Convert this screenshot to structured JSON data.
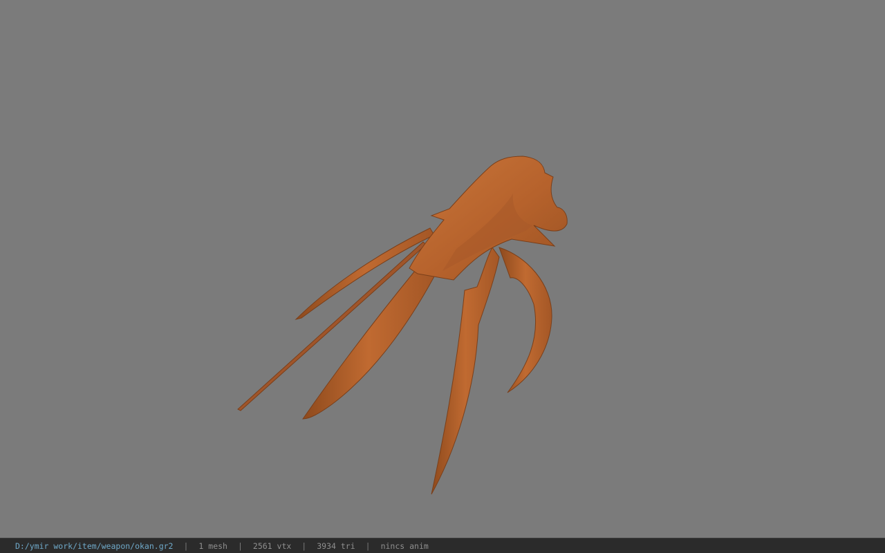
{
  "viewport": {
    "background": "#7b7b7b",
    "model_color": "#b9652e",
    "model_shade": "#8f4a1e",
    "model_highlight": "#cf7c40"
  },
  "statusbar": {
    "path": "D:/ymir work/item/weapon/okan.gr2",
    "separator": "|",
    "mesh": "1 mesh",
    "vertices": "2561 vtx",
    "triangles": "3934 tri",
    "anim": "nincs anim"
  }
}
